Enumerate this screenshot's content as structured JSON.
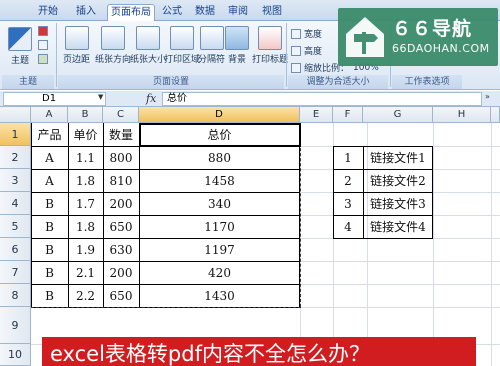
{
  "ribbon": {
    "tabs": [
      "开始",
      "插入",
      "页面布局",
      "公式",
      "数据",
      "审阅",
      "视图"
    ],
    "active_tab": "页面布局",
    "groups": {
      "theme": {
        "label": "主题",
        "button": "主题"
      },
      "page_setup": {
        "label": "页面设置",
        "buttons": [
          "页边距",
          "纸张方向",
          "纸张大小",
          "打印区域",
          "分隔符",
          "背景",
          "打印标题"
        ]
      },
      "scale": {
        "label": "调整为合适大小",
        "rows": [
          "宽度",
          "高度",
          "缩放比例：",
          "100%"
        ]
      },
      "options": {
        "label": "工作表选项"
      }
    }
  },
  "logo": {
    "brand": "６６导航",
    "url": "66DAOHAN.COM"
  },
  "formula_bar": {
    "name_box": "D1",
    "fx": "fx",
    "content": "总价"
  },
  "sheet": {
    "columns": [
      "A",
      "B",
      "C",
      "D",
      "E",
      "F",
      "G",
      "H"
    ],
    "rows": [
      "1",
      "2",
      "3",
      "4",
      "5",
      "6",
      "7",
      "8",
      "9",
      "10"
    ],
    "table": {
      "headers": [
        "产品",
        "单价",
        "数量",
        "总价"
      ],
      "rows": [
        [
          "A",
          "1.1",
          "800",
          "880"
        ],
        [
          "A",
          "1.8",
          "810",
          "1458"
        ],
        [
          "B",
          "1.7",
          "200",
          "340"
        ],
        [
          "B",
          "1.8",
          "650",
          "1170"
        ],
        [
          "B",
          "1.9",
          "630",
          "1197"
        ],
        [
          "B",
          "2.1",
          "200",
          "420"
        ],
        [
          "B",
          "2.2",
          "650",
          "1430"
        ]
      ]
    },
    "links": [
      {
        "num": "1",
        "label": "链接文件1"
      },
      {
        "num": "2",
        "label": "链接文件2"
      },
      {
        "num": "3",
        "label": "链接文件3"
      },
      {
        "num": "4",
        "label": "链接文件4"
      }
    ]
  },
  "banner": {
    "text": "excel表格转pdf内容不全怎么办？"
  },
  "colors": {
    "accent": "#d11d1f",
    "logo": "#3b8b6b",
    "selection": "#f1c15f"
  }
}
